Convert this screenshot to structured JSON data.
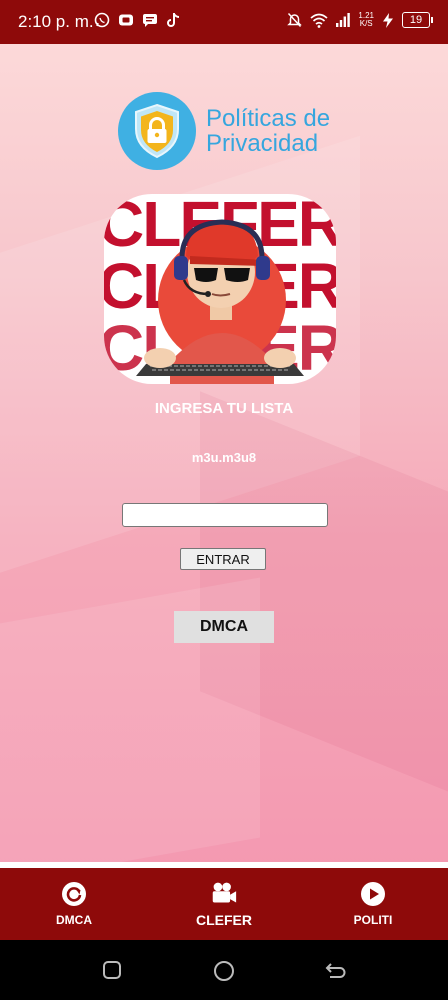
{
  "status_bar": {
    "time": "2:10 p. m.",
    "network_speed": "1.21\nK/S",
    "battery": "19",
    "left_icons": [
      "whatsapp-icon",
      "youtube-icon",
      "messages-icon",
      "tiktok-icon"
    ],
    "right_icons": [
      "mute-bell-icon",
      "wifi-icon",
      "signal-icon",
      "charging-icon"
    ]
  },
  "header_logo": {
    "line1": "Políticas de",
    "line2": "Privacidad",
    "icon": "shield-lock-icon"
  },
  "avatar": {
    "brand_rows": [
      "CLEFER",
      "CLEFER",
      "CLEFER"
    ]
  },
  "form": {
    "heading": "INGRESA TU LISTA",
    "hint": "m3u.m3u8",
    "input_value": "",
    "input_placeholder": "",
    "submit_label": "ENTRAR"
  },
  "dmca_button": {
    "label": "DMCA"
  },
  "bottom_nav": {
    "items": [
      {
        "label": "DMCA",
        "icon": "refresh-circle-icon"
      },
      {
        "label": "CLEFER",
        "icon": "video-camera-icon"
      },
      {
        "label": "POLITI",
        "icon": "play-circle-icon"
      }
    ]
  },
  "system_nav": {
    "buttons": [
      "recents-icon",
      "home-icon",
      "back-icon"
    ]
  },
  "colors": {
    "brand_red": "#8e0a0a",
    "logo_blue": "#36a6de",
    "clefer_red": "#c3102e"
  }
}
